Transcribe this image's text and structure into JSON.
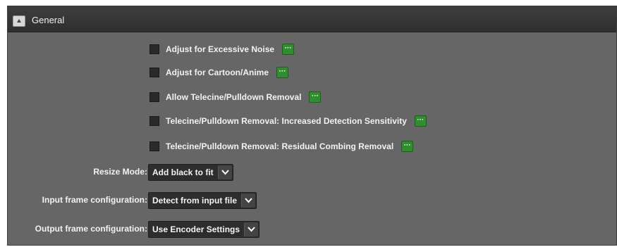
{
  "panel": {
    "title": "General",
    "collapse_icon": "collapse-up-icon"
  },
  "checkboxes": [
    {
      "label": "Adjust for Excessive Noise",
      "checked": false
    },
    {
      "label": "Adjust for Cartoon/Anime",
      "checked": false
    },
    {
      "label": "Allow Telecine/Pulldown Removal",
      "checked": false
    },
    {
      "label": "Telecine/Pulldown Removal: Increased Detection Sensitivity",
      "checked": false
    },
    {
      "label": "Telecine/Pulldown Removal: Residual Combing Removal",
      "checked": false
    }
  ],
  "more_button": {
    "glyph": "···",
    "color": "#2f8f2f",
    "icon": "ellipsis-icon"
  },
  "fields": {
    "resize_mode": {
      "label": "Resize Mode:",
      "value": "Add black to fit"
    },
    "input_frame": {
      "label": "Input frame configuration:",
      "value": "Detect from input file"
    },
    "output_frame": {
      "label": "Output frame configuration:",
      "value": "Use Encoder Settings"
    }
  },
  "colors": {
    "panel_bg": "#666666",
    "header_bg": "#333333",
    "accent_green": "#2f8f2f"
  }
}
